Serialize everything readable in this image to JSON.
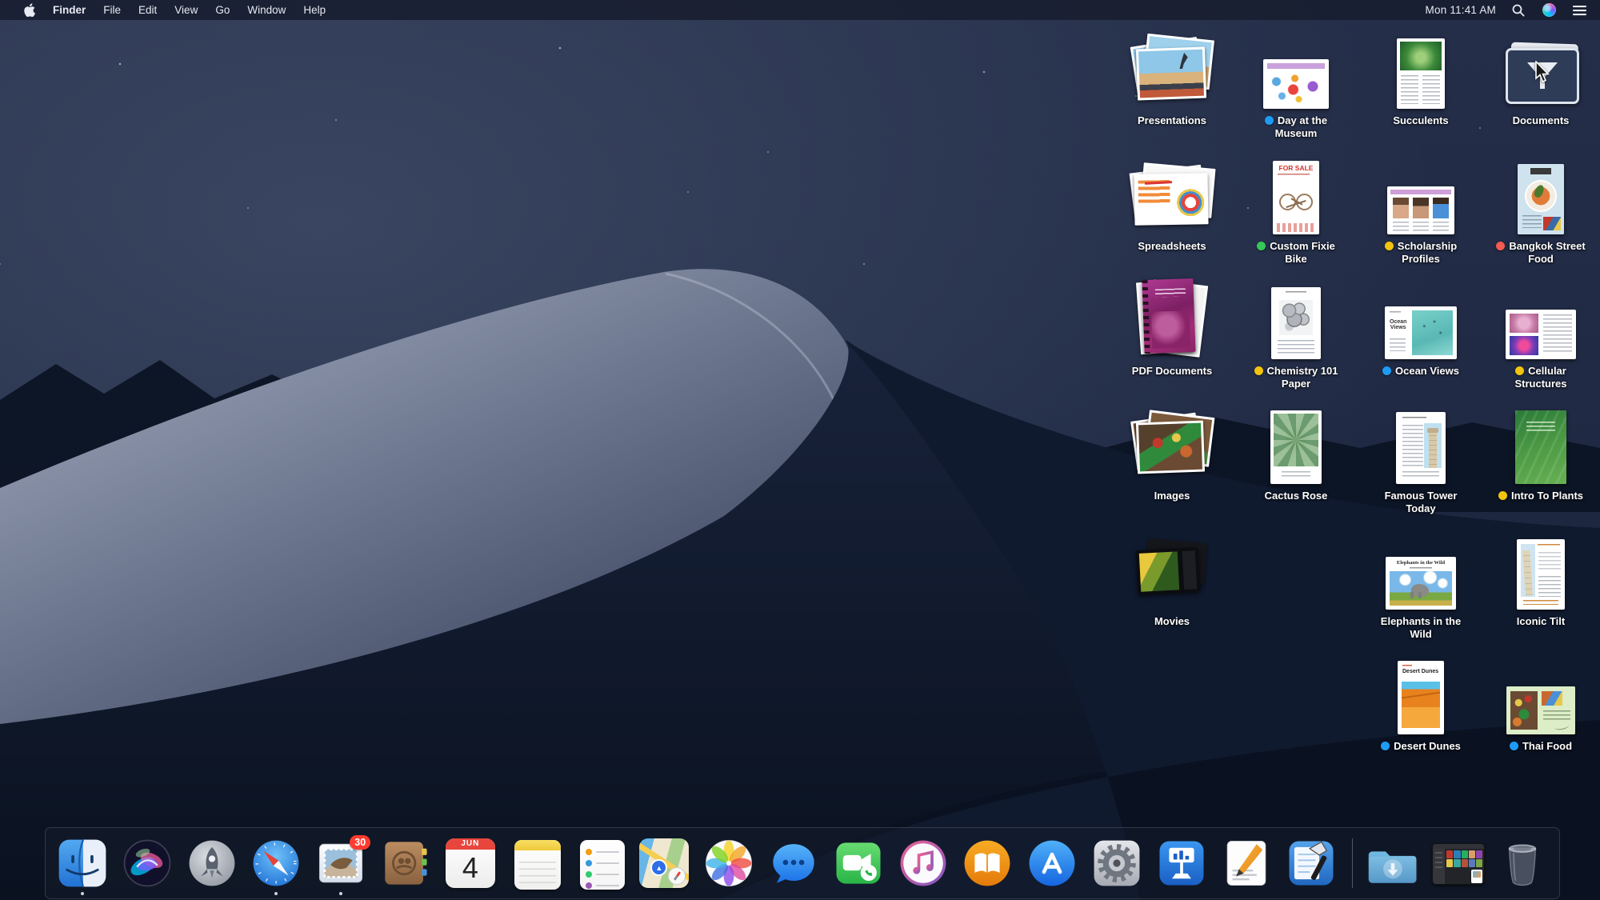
{
  "menubar": {
    "apple_icon": "apple-logo",
    "menus": [
      "Finder",
      "File",
      "Edit",
      "View",
      "Go",
      "Window",
      "Help"
    ],
    "clock": "Mon 11:41 AM",
    "status_icons": [
      "spotlight-search",
      "siri",
      "notification-center"
    ]
  },
  "desktop": {
    "wallpaper": "macos-mojave-night-dunes",
    "tag_colors": {
      "blue": "#1e9bf5",
      "green": "#35c759",
      "yellow": "#f2c40e",
      "red": "#f45b51"
    },
    "stacks": [
      {
        "label": "Presentations",
        "tag": null,
        "col": 1,
        "row": 1,
        "kind": "stack",
        "art": "photo-beach"
      },
      {
        "label": "Day at the Museum",
        "tag": "blue",
        "col": 2,
        "row": 1,
        "kind": "document",
        "art": "doc-museum"
      },
      {
        "label": "Succulents",
        "tag": null,
        "col": 3,
        "row": 1,
        "kind": "document",
        "art": "doc-succulents"
      },
      {
        "label": "Documents",
        "tag": null,
        "col": 4,
        "row": 1,
        "kind": "stack",
        "art": "filter-stack",
        "cursor": true
      },
      {
        "label": "Spreadsheets",
        "tag": null,
        "col": 1,
        "row": 2,
        "kind": "stack",
        "art": "paper-charts"
      },
      {
        "label": "Custom Fixie Bike",
        "tag": "green",
        "col": 2,
        "row": 2,
        "kind": "document",
        "art": "poster-bike",
        "title_text": "FOR SALE"
      },
      {
        "label": "Scholarship Profiles",
        "tag": "yellow",
        "col": 3,
        "row": 2,
        "kind": "document",
        "art": "doc-profiles"
      },
      {
        "label": "Bangkok Street Food",
        "tag": "red",
        "col": 4,
        "row": 2,
        "kind": "document",
        "art": "doc-bangkok"
      },
      {
        "label": "PDF Documents",
        "tag": null,
        "col": 1,
        "row": 3,
        "kind": "stack",
        "art": "book-stack"
      },
      {
        "label": "Chemistry 101 Paper",
        "tag": "yellow",
        "col": 2,
        "row": 3,
        "kind": "document",
        "art": "doc-chemistry"
      },
      {
        "label": "Ocean Views",
        "tag": "blue",
        "col": 3,
        "row": 3,
        "kind": "document",
        "art": "doc-ocean",
        "title_text": "Ocean Views"
      },
      {
        "label": "Cellular Structures",
        "tag": "yellow",
        "col": 4,
        "row": 3,
        "kind": "document",
        "art": "doc-cells"
      },
      {
        "label": "Images",
        "tag": null,
        "col": 1,
        "row": 4,
        "kind": "stack",
        "art": "photo-market"
      },
      {
        "label": "Cactus Rose",
        "tag": null,
        "col": 2,
        "row": 4,
        "kind": "document",
        "art": "doc-cactus"
      },
      {
        "label": "Famous Tower Today",
        "tag": null,
        "col": 3,
        "row": 4,
        "kind": "document",
        "art": "doc-tower"
      },
      {
        "label": "Intro To Plants",
        "tag": "yellow",
        "col": 4,
        "row": 4,
        "kind": "document",
        "art": "doc-plants"
      },
      {
        "label": "Movies",
        "tag": null,
        "col": 1,
        "row": 5,
        "kind": "stack",
        "art": "video-stack"
      },
      {
        "label": "Elephants in the Wild",
        "tag": null,
        "col": 3,
        "row": 5,
        "kind": "document",
        "art": "doc-elephants",
        "title_text": "Elephants in the Wild"
      },
      {
        "label": "Iconic Tilt",
        "tag": null,
        "col": 4,
        "row": 5,
        "kind": "document",
        "art": "doc-pisa"
      },
      {
        "label": "Desert Dunes",
        "tag": "blue",
        "col": 3,
        "row": 6,
        "kind": "document",
        "art": "doc-dunes",
        "title_text": "Desert Dunes"
      },
      {
        "label": "Thai Food",
        "tag": "blue",
        "col": 4,
        "row": 6,
        "kind": "document",
        "art": "doc-thai"
      }
    ]
  },
  "dock": {
    "mail_badge": "30",
    "calendar": {
      "month": "JUN",
      "day": "4"
    },
    "items": [
      {
        "name": "Finder",
        "type": "finder",
        "running": true
      },
      {
        "name": "Siri",
        "type": "siri"
      },
      {
        "name": "Launchpad",
        "type": "launchpad"
      },
      {
        "name": "Safari",
        "type": "safari",
        "running": true
      },
      {
        "name": "Mail",
        "type": "mail",
        "running": true,
        "badge": "30"
      },
      {
        "name": "Contacts",
        "type": "contacts"
      },
      {
        "name": "Calendar",
        "type": "calendar"
      },
      {
        "name": "Notes",
        "type": "notes"
      },
      {
        "name": "Reminders",
        "type": "reminders"
      },
      {
        "name": "Maps",
        "type": "maps"
      },
      {
        "name": "Photos",
        "type": "photos"
      },
      {
        "name": "Messages",
        "type": "messages"
      },
      {
        "name": "FaceTime",
        "type": "facetime"
      },
      {
        "name": "iTunes",
        "type": "itunes"
      },
      {
        "name": "Books",
        "type": "books"
      },
      {
        "name": "App Store",
        "type": "appstore"
      },
      {
        "name": "System Preferences",
        "type": "sysprefs"
      },
      {
        "name": "Keynote",
        "type": "keynote"
      },
      {
        "name": "Pages",
        "type": "pages"
      },
      {
        "name": "Xcode",
        "type": "xcode"
      },
      {
        "name": "separator",
        "type": "separator"
      },
      {
        "name": "Downloads",
        "type": "downloads"
      },
      {
        "name": "Minimized Window",
        "type": "minwindow"
      },
      {
        "name": "Trash",
        "type": "trash"
      }
    ]
  }
}
